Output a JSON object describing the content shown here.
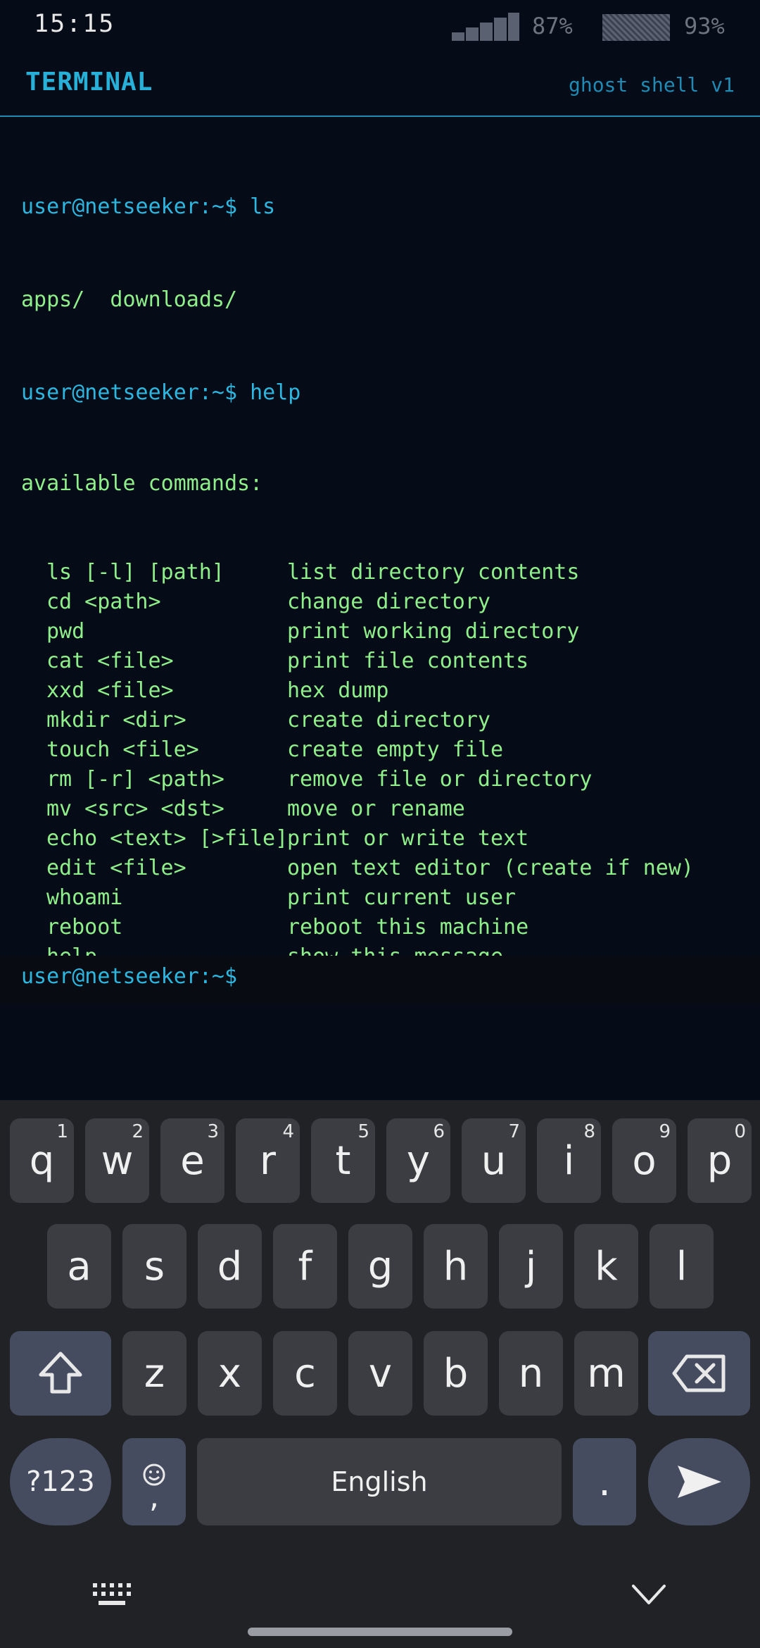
{
  "status": {
    "time": "15:15",
    "signal_pct": "87%",
    "battery_pct": "93%"
  },
  "header": {
    "title": "TERMINAL",
    "subtitle": "ghost shell v1"
  },
  "terminal": {
    "lines": [
      {
        "text": "user@netseeker:~$ ls",
        "type": "prompt"
      },
      {
        "text": "apps/  downloads/",
        "type": "output"
      },
      {
        "text": "user@netseeker:~$ help",
        "type": "prompt"
      },
      {
        "text": "available commands:",
        "type": "output"
      }
    ],
    "help_rows": [
      {
        "cmd": "ls [-l] [path]",
        "desc": "list directory contents"
      },
      {
        "cmd": "cd <path>",
        "desc": "change directory"
      },
      {
        "cmd": "pwd",
        "desc": "print working directory"
      },
      {
        "cmd": "cat <file>",
        "desc": "print file contents"
      },
      {
        "cmd": "xxd <file>",
        "desc": "hex dump"
      },
      {
        "cmd": "mkdir <dir>",
        "desc": "create directory"
      },
      {
        "cmd": "touch <file>",
        "desc": "create empty file"
      },
      {
        "cmd": "rm [-r] <path>",
        "desc": "remove file or directory"
      },
      {
        "cmd": "mv <src> <dst>",
        "desc": "move or rename"
      },
      {
        "cmd": "echo <text> [>file]",
        "desc": "print or write text"
      },
      {
        "cmd": "edit <file>",
        "desc": "open text editor (create if new)"
      },
      {
        "cmd": "whoami",
        "desc": "print current user"
      },
      {
        "cmd": "reboot",
        "desc": "reboot this machine"
      },
      {
        "cmd": "help",
        "desc": "show this message"
      }
    ],
    "input_prompt": "user@netseeker:~$"
  },
  "keyboard": {
    "row1": [
      {
        "k": "q",
        "h": "1"
      },
      {
        "k": "w",
        "h": "2"
      },
      {
        "k": "e",
        "h": "3"
      },
      {
        "k": "r",
        "h": "4"
      },
      {
        "k": "t",
        "h": "5"
      },
      {
        "k": "y",
        "h": "6"
      },
      {
        "k": "u",
        "h": "7"
      },
      {
        "k": "i",
        "h": "8"
      },
      {
        "k": "o",
        "h": "9"
      },
      {
        "k": "p",
        "h": "0"
      }
    ],
    "row2": [
      "a",
      "s",
      "d",
      "f",
      "g",
      "h",
      "j",
      "k",
      "l"
    ],
    "row3": [
      "z",
      "x",
      "c",
      "v",
      "b",
      "n",
      "m"
    ],
    "sym_label": "?123",
    "emoji_comma": ",",
    "space_label": "English",
    "period": ".",
    "icons": [
      "shift-icon",
      "backspace-icon",
      "emoji-icon",
      "send-icon",
      "keyboard-switch-icon",
      "hide-keyboard-icon"
    ]
  },
  "colors": {
    "bg": "#050b17",
    "accent": "#27b1d9",
    "output": "#8ff08b",
    "keyboard": "#202226"
  }
}
